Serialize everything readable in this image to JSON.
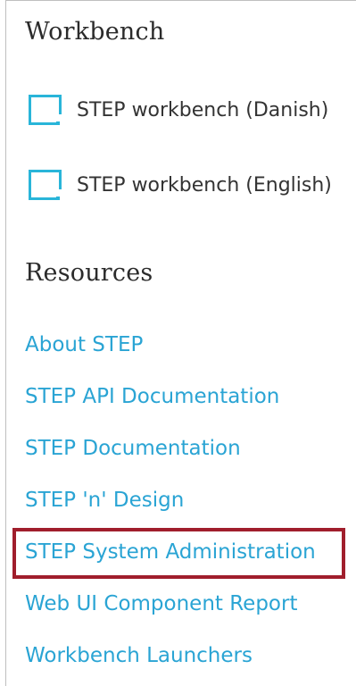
{
  "workbench": {
    "heading": "Workbench",
    "launchers": [
      {
        "label": "STEP workbench (Danish)",
        "icon": "workbench-launcher-icon"
      },
      {
        "label": "STEP workbench (English)",
        "icon": "workbench-launcher-icon"
      }
    ]
  },
  "resources": {
    "heading": "Resources",
    "links": [
      {
        "label": "About STEP"
      },
      {
        "label": "STEP API Documentation"
      },
      {
        "label": "STEP Documentation"
      },
      {
        "label": "STEP 'n' Design"
      },
      {
        "label": "STEP System Administration",
        "highlighted": true
      },
      {
        "label": "Web UI Component Report"
      },
      {
        "label": "Workbench Launchers"
      }
    ]
  },
  "colors": {
    "link": "#2aa4d4",
    "icon": "#29b5d9",
    "highlight": "#a01e2c",
    "heading": "#2b2b2b"
  }
}
